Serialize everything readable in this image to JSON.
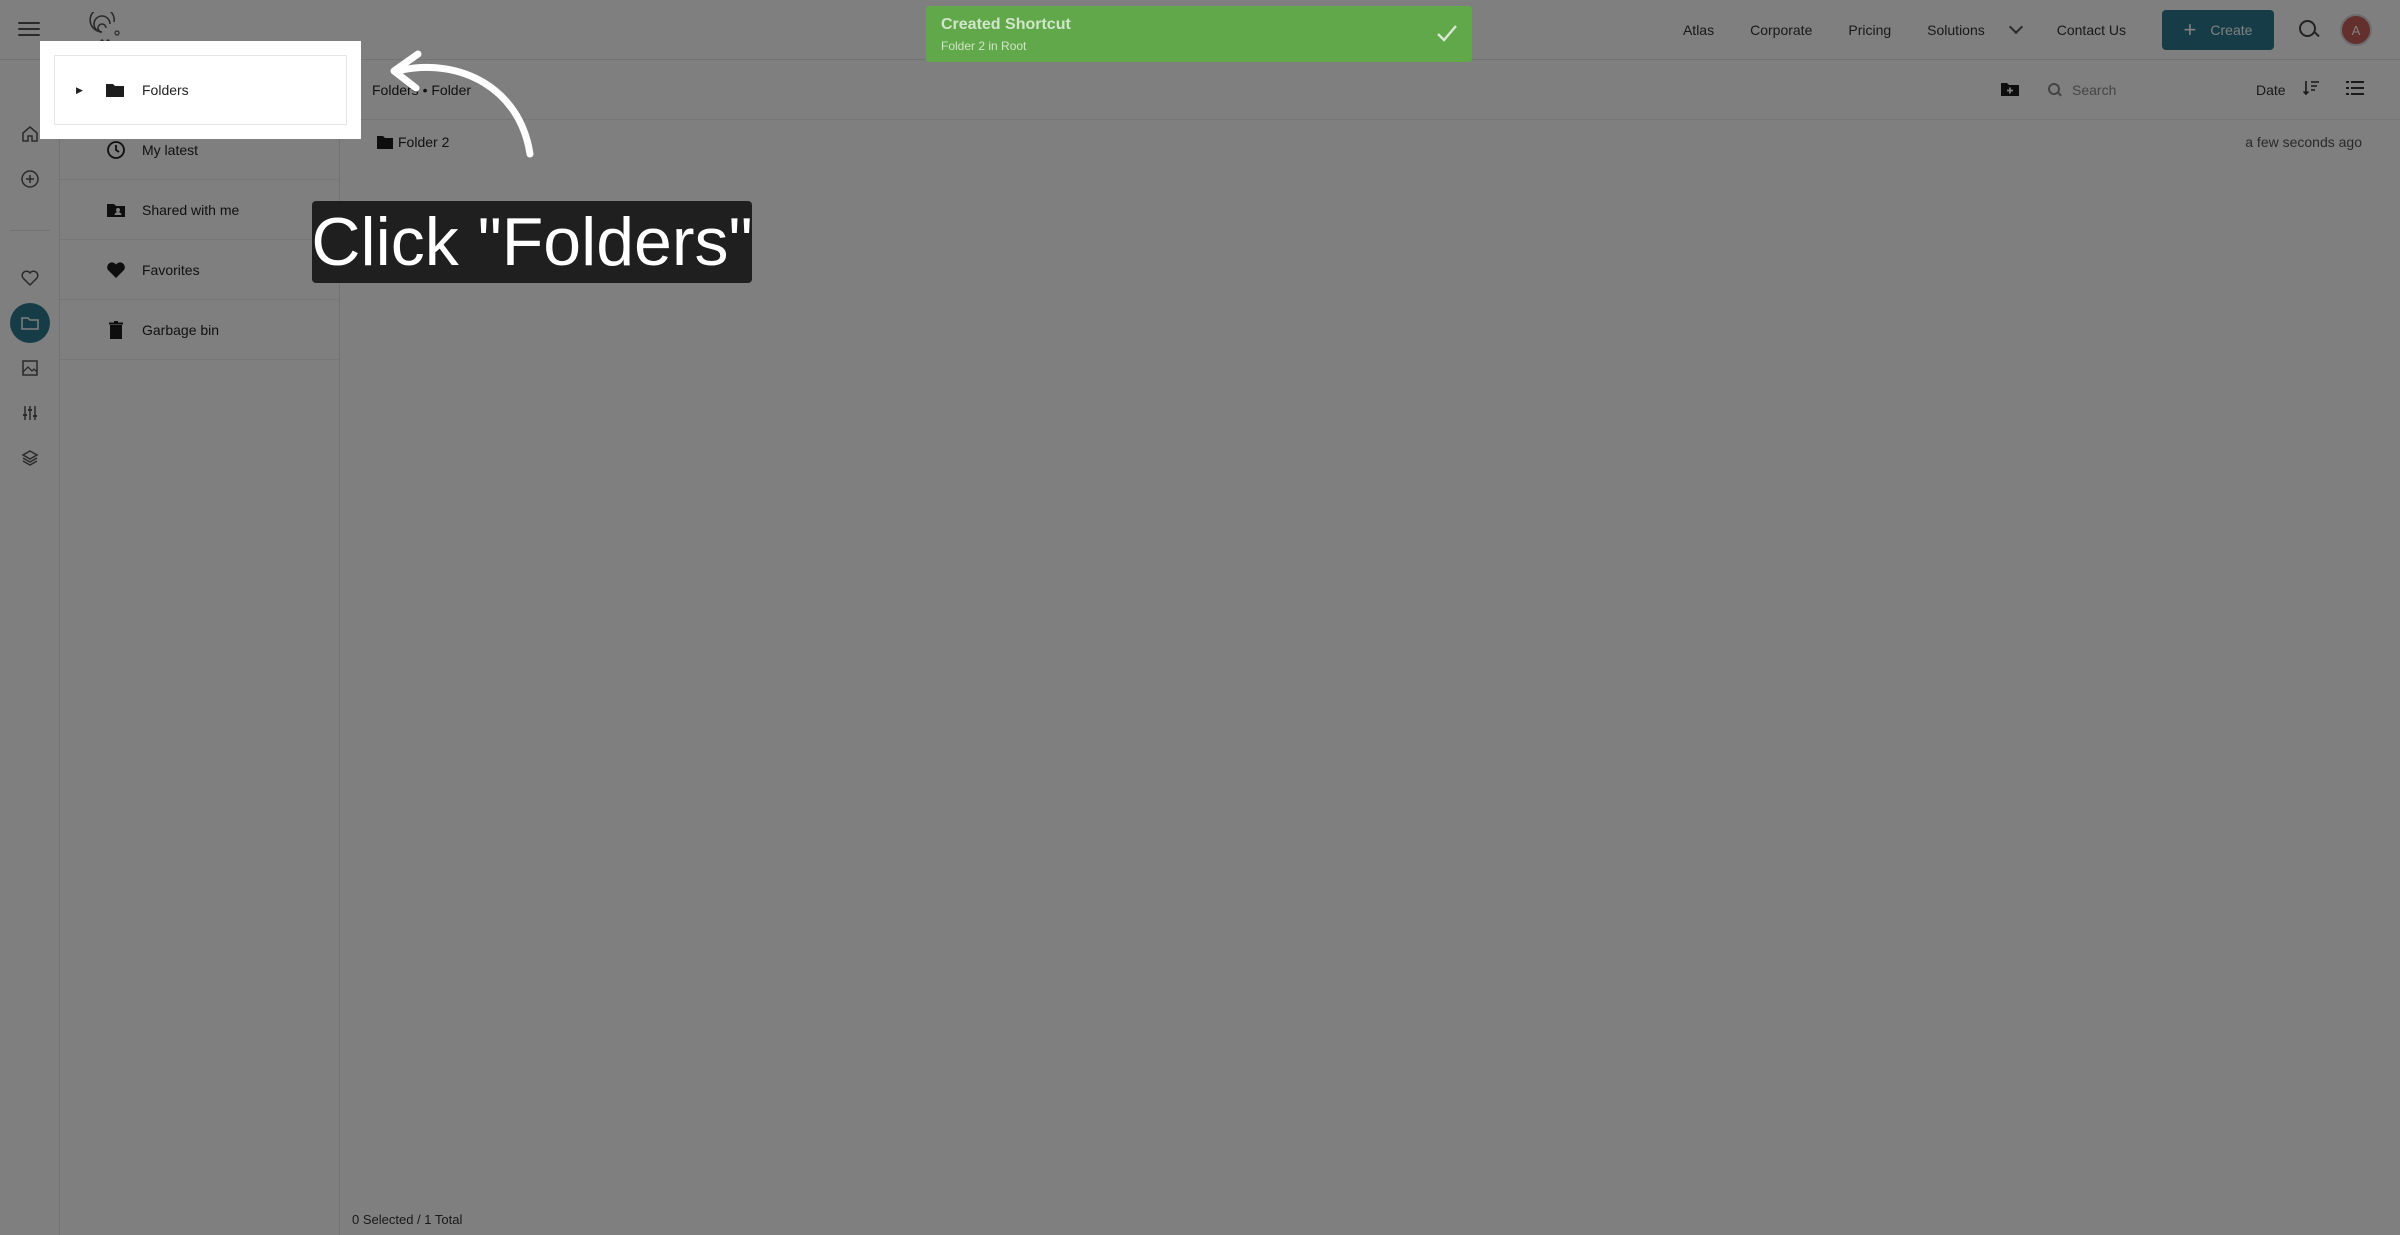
{
  "topnav": {
    "links": [
      "Atlas",
      "Corporate",
      "Pricing"
    ],
    "solutions_label": "Solutions",
    "contact_label": "Contact Us",
    "create_label": "Create",
    "avatar_initial": "A"
  },
  "sidebar": {
    "items": [
      {
        "label": "Folders",
        "icon": "folder-icon"
      },
      {
        "label": "My latest",
        "icon": "clock-icon"
      },
      {
        "label": "Shared with me",
        "icon": "shared-folder-icon"
      },
      {
        "label": "Favorites",
        "icon": "heart-icon"
      },
      {
        "label": "Garbage bin",
        "icon": "trash-icon"
      }
    ]
  },
  "toolbar": {
    "breadcrumb": "Folders • Folder",
    "search_placeholder": "Search",
    "sort_label": "Date"
  },
  "files": [
    {
      "name": "Folder 2",
      "modified": "a few seconds ago"
    }
  ],
  "footer": {
    "selection_text": "0 Selected / 1 Total"
  },
  "toast": {
    "title": "Created Shortcut",
    "subtitle": "Folder 2 in Root"
  },
  "callout": {
    "text": "Click \"Folders\""
  },
  "colors": {
    "accent": "#2c7a8f",
    "toast": "#61a84a",
    "overlay": "rgba(0,0,0,0.5)"
  }
}
